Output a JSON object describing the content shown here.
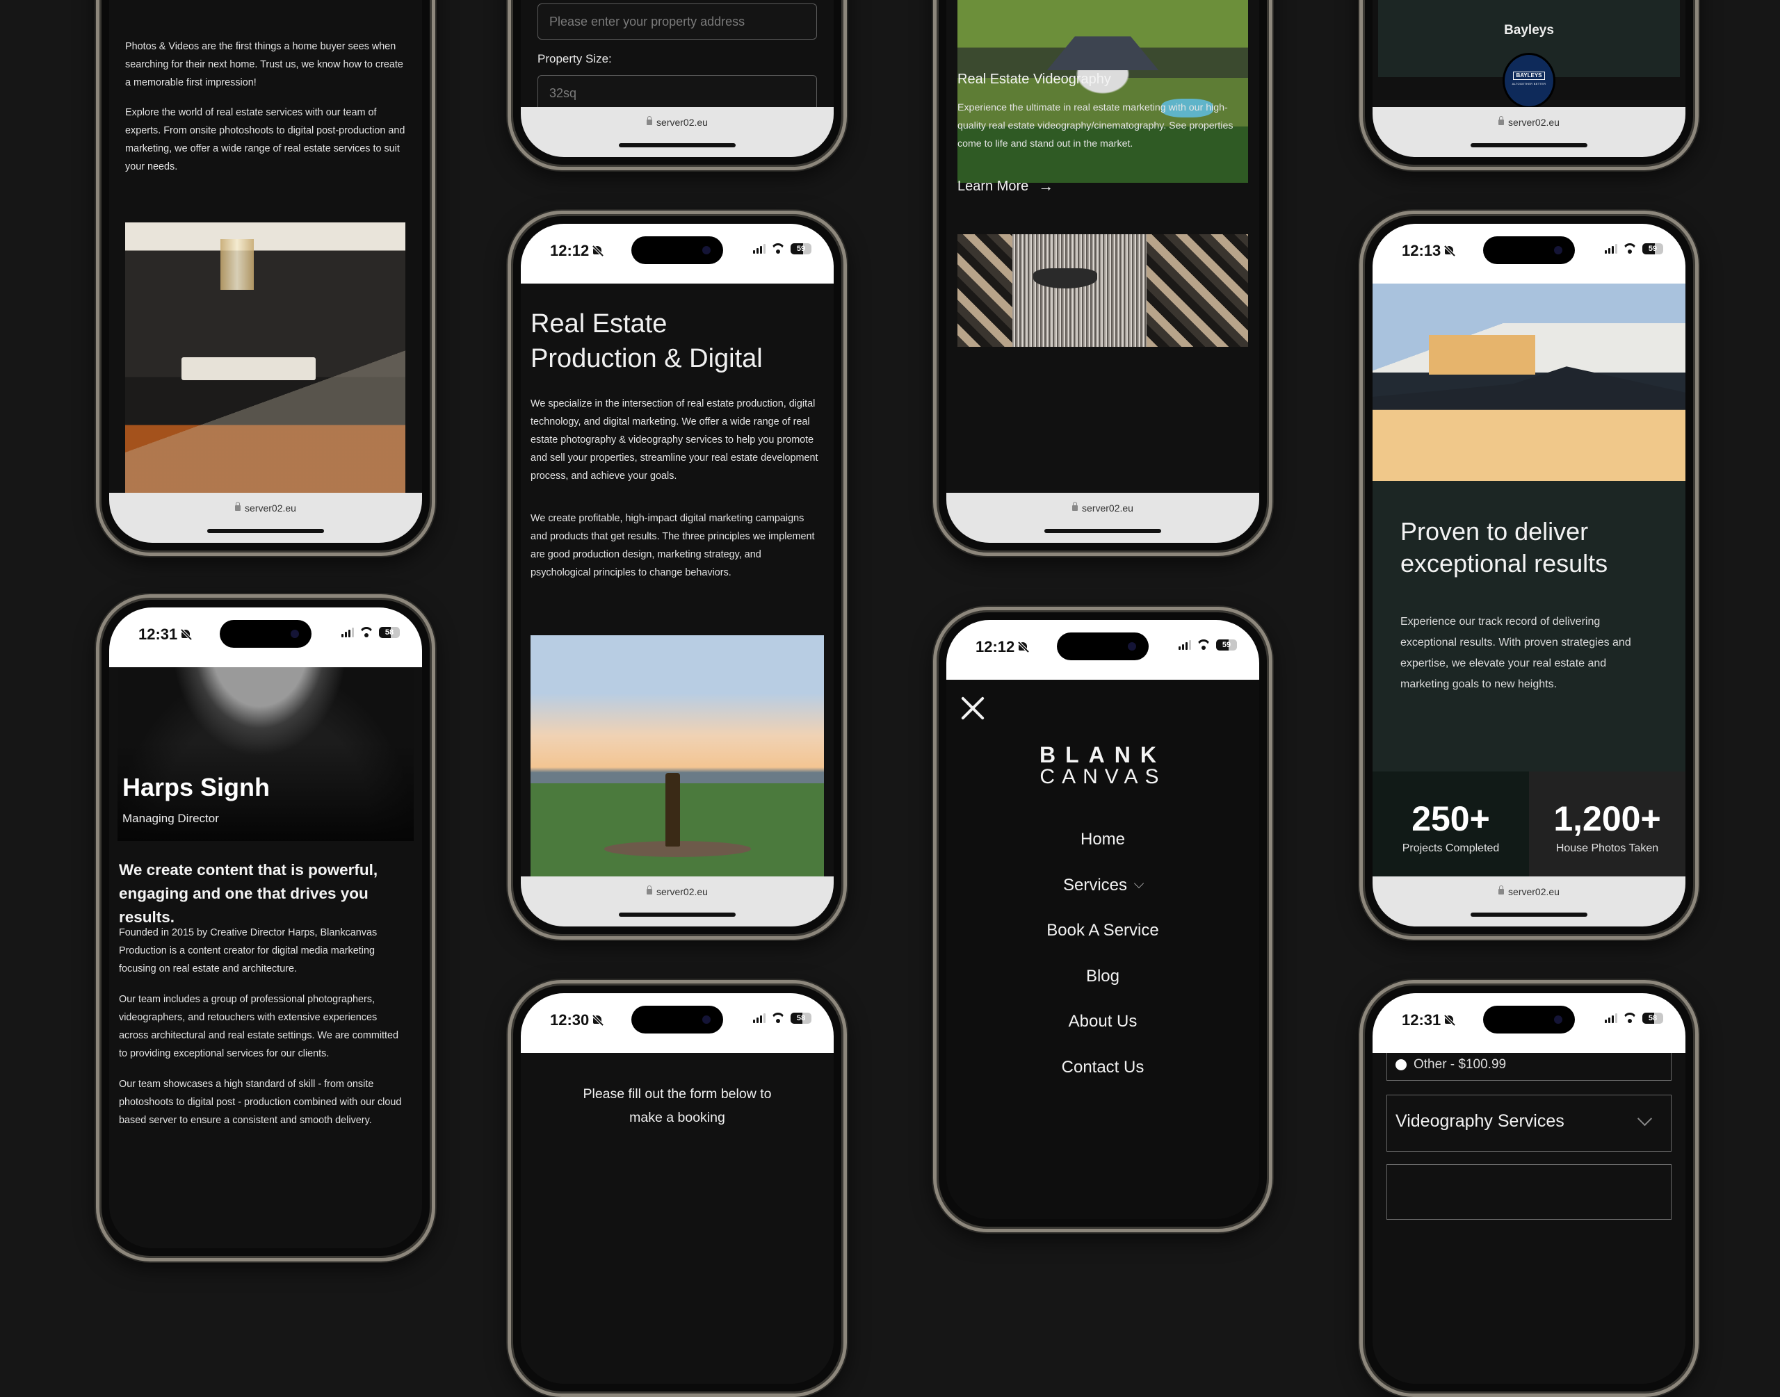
{
  "common": {
    "url": "server02.eu"
  },
  "phone_about_top": {
    "paragraphs": [
      "Photos & Videos are the first things a home buyer sees when searching for their next home. Trust us, we know how to create a memorable first impression!",
      "Explore the world of real estate services with our team of experts. From onsite photoshoots to digital post-production and marketing, we offer a wide range of real estate services to suit your needs."
    ],
    "image_alt": "Modern dark kitchen interior with pendant chandelier and bar stools"
  },
  "phone_team": {
    "status": {
      "time": "12:31",
      "battery": "58",
      "battery_level": 0.58
    },
    "image_alt": "Black and white portrait of Harps Signh",
    "name": "Harps Signh",
    "role": "Managing Director",
    "headline": "We create content that is powerful, engaging and one that drives you results.",
    "paragraphs": [
      "Founded in 2015 by Creative Director Harps, Blankcanvas Production is a content creator for digital media marketing focusing on real estate and architecture.",
      "Our team includes a group of professional photographers, videographers, and retouchers with extensive experiences across architectural and real estate settings. We are committed to providing exceptional services for our clients.",
      "Our team showcases a high standard of skill - from onsite photoshoots to digital post - production combined with our cloud based server to ensure a consistent and smooth delivery."
    ]
  },
  "phone_form_top": {
    "address_placeholder": "Please enter your property address",
    "size_label": "Property Size:",
    "size_placeholder": "32sq"
  },
  "phone_intro": {
    "status": {
      "time": "12:12",
      "battery": "59",
      "battery_level": 0.59
    },
    "title_line1": "Real Estate",
    "title_line2": "Production & Digital",
    "paragraphs": [
      "We specialize in the intersection of real estate production, digital technology, and digital marketing. We offer a wide range of real estate photography & videography services to help you promote and sell your properties, streamline your real estate development process, and achieve your goals.",
      "We create profitable, high-impact digital marketing campaigns and products that get results. The three principles we implement are good production design, marketing strategy, and psychological principles to change behaviors."
    ],
    "image_alt": "Champagne bottle on balcony table overlooking city at sunset"
  },
  "phone_booking": {
    "status": {
      "time": "12:30",
      "battery": "58",
      "battery_level": 0.58
    },
    "intro": "Please fill out the form below to make a booking"
  },
  "phone_services": {
    "image_top_alt": "Aerial view of luxury home with pool and gardens",
    "service_title": "Real Estate Videography",
    "service_desc": "Experience the ultimate in real estate marketing with our high-quality real estate videography/cinematography. See properties come to life and stand out in the market.",
    "learn_more": "Learn More",
    "image_bottom_alt": "Geometric art wall with pixel portrait"
  },
  "phone_menu": {
    "status": {
      "time": "12:12",
      "battery": "59",
      "battery_level": 0.59
    },
    "logo_line1": "BLANK",
    "logo_line2": "CANVAS",
    "items": [
      {
        "label": "Home",
        "has_dropdown": false
      },
      {
        "label": "Services",
        "has_dropdown": true
      },
      {
        "label": "Book A Service",
        "has_dropdown": false
      },
      {
        "label": "Blog",
        "has_dropdown": false
      },
      {
        "label": "About Us",
        "has_dropdown": false
      },
      {
        "label": "Contact Us",
        "has_dropdown": false
      }
    ]
  },
  "phone_clients": {
    "client_name": "Bayleys",
    "client_logo_text": "BAYLEYS",
    "client_logo_tagline": "ALTOGETHER BETTER",
    "colors": {
      "panel": "#1c2624",
      "logo_bg": "#0e2a5a"
    }
  },
  "phone_results": {
    "status": {
      "time": "12:13",
      "battery": "59",
      "battery_level": 0.59
    },
    "image_alt": "Lit two-storey weatherboard house at dusk",
    "title": "Proven to deliver exceptional results",
    "desc": "Experience our track record of delivering exceptional results. With proven strategies and expertise, we elevate your real estate and marketing goals to new heights.",
    "stats": [
      {
        "value": "250+",
        "label": "Projects Completed"
      },
      {
        "value": "1,200+",
        "label": "House Photos Taken"
      }
    ],
    "colors": {
      "panel": "#1c2624",
      "stat1_bg": "#111a17",
      "stat2_bg": "#222222"
    }
  },
  "phone_booking_form": {
    "status": {
      "time": "12:31",
      "battery": "58",
      "battery_level": 0.58
    },
    "radio_option": "Other - $100.99",
    "select_value": "Videography Services"
  }
}
